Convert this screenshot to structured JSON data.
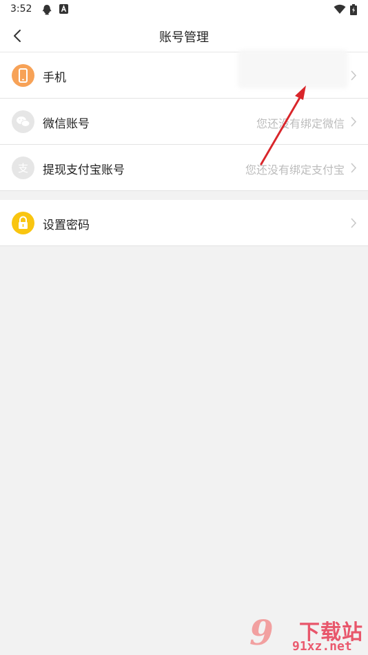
{
  "status_bar": {
    "time": "3:52",
    "icons": [
      "qq-icon",
      "a-notification-icon",
      "wifi-icon",
      "battery-charging-icon"
    ]
  },
  "app_bar": {
    "back_icon": "chevron-left-icon",
    "title": "账号管理"
  },
  "account_rows": [
    {
      "label": "手机",
      "value": "",
      "icon": "phone-icon",
      "icon_color": "#f7a257"
    },
    {
      "label": "微信账号",
      "value": "您还没有绑定微信",
      "icon": "wechat-icon",
      "icon_color": "#e6e6e6"
    },
    {
      "label": "提现支付宝账号",
      "value": "您还没有绑定支付宝",
      "icon": "alipay-icon",
      "icon_color": "#e6e6e6"
    }
  ],
  "security_rows": [
    {
      "label": "设置密码",
      "value": "",
      "icon": "lock-icon",
      "icon_color": "#f9c510"
    }
  ],
  "annotation": {
    "arrow_color": "#d9262b"
  },
  "watermark": {
    "logo_text": "9",
    "cn_text": "下载站",
    "domain": "91xz.net"
  },
  "colors": {
    "page_bg": "#f2f2f2",
    "card_bg": "#ffffff",
    "value_text": "#bcbcbc"
  }
}
